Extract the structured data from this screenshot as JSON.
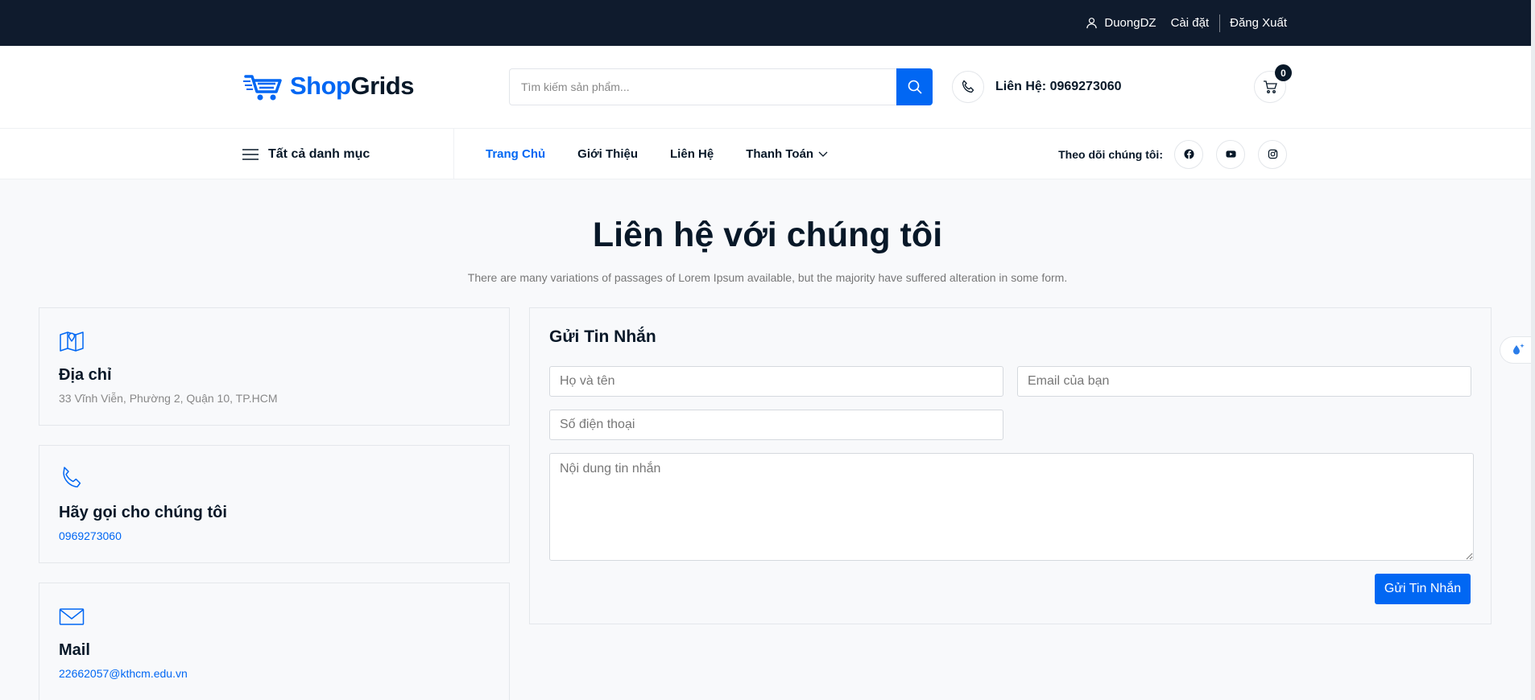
{
  "topbar": {
    "username": "DuongDZ",
    "settings": "Cài đặt",
    "logout": "Đăng Xuất"
  },
  "header": {
    "logo_part1": "Shop",
    "logo_part2": "Grids",
    "search_placeholder": "Tìm kiếm sản phẩm...",
    "contact_label": "Liên Hệ: 0969273060",
    "cart_count": "0"
  },
  "nav": {
    "categories": "Tất cả danh mục",
    "menu": [
      "Trang Chủ",
      "Giới Thiệu",
      "Liên Hệ",
      "Thanh Toán"
    ],
    "follow_label": "Theo dõi chúng tôi:"
  },
  "section": {
    "title": "Liên hệ với chúng tôi",
    "subtitle": "There are many variations of passages of Lorem Ipsum available, but the majority have suffered alteration in some form."
  },
  "cards": [
    {
      "title": "Địa chỉ",
      "value": "33 Vĩnh Viễn, Phường 2, Quận 10, TP.HCM"
    },
    {
      "title": "Hãy gọi cho chúng tôi",
      "value": "0969273060"
    },
    {
      "title": "Mail",
      "value": "22662057@kthcm.edu.vn"
    }
  ],
  "form": {
    "title": "Gửi Tin Nhắn",
    "name_placeholder": "Họ và tên",
    "email_placeholder": "Email của bạn",
    "phone_placeholder": "Số điện thoại",
    "message_placeholder": "Nội dung tin nhắn",
    "submit": "Gửi Tin Nhắn"
  },
  "colors": {
    "accent": "#0167f3",
    "topbar": "#0f1b2d",
    "text": "#081828"
  }
}
